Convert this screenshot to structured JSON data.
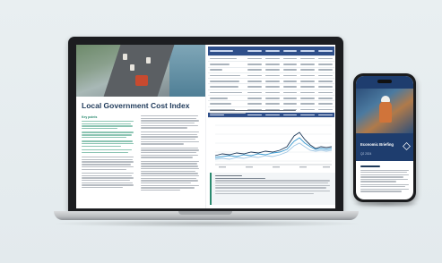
{
  "document": {
    "title": "Local Government Cost Index",
    "key_points_heading": "Key points"
  },
  "phone_cover": {
    "title": "Economic Briefing",
    "subtitle": "Q2 2024"
  },
  "colors": {
    "navy": "#1f3a5a",
    "table_header": "#2f4f8a",
    "accent_teal": "#2a8a6f",
    "chart_series_1": "#1f3a5a",
    "chart_series_2": "#3a9bd2",
    "chart_series_3": "#9fc6e4"
  },
  "icons": {
    "phone_logo": "diamond-logo-icon"
  }
}
